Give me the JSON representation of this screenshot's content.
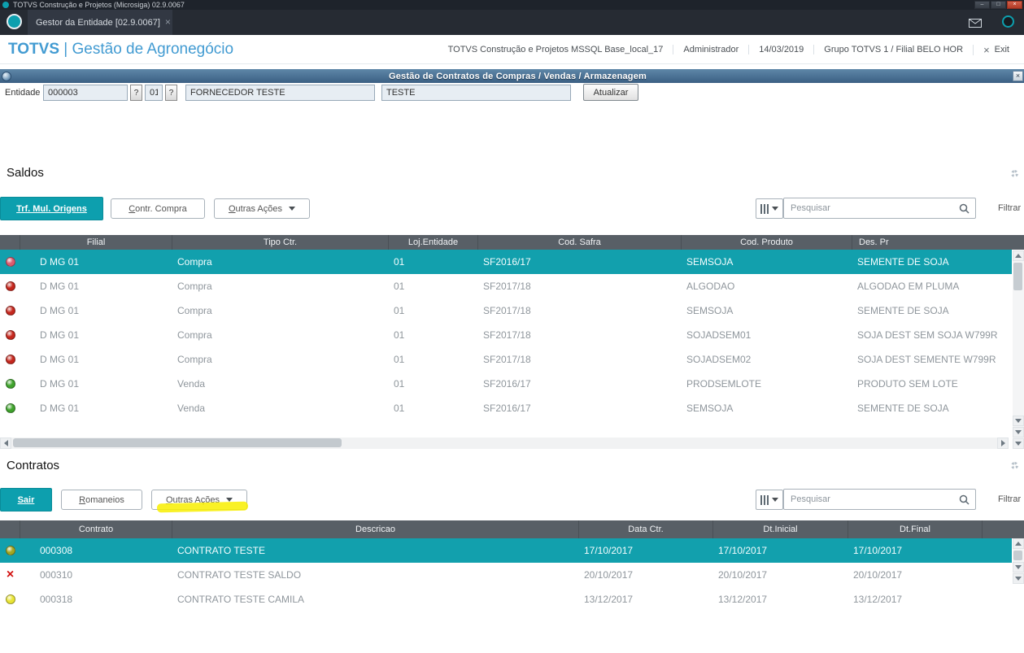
{
  "window": {
    "title": "TOTVS Construção e Projetos (Microsiga) 02.9.0067",
    "minimize": "–",
    "maximize": "□",
    "close": "×"
  },
  "tabbar": {
    "tab_label": "Gestor da Entidade [02.9.0067]",
    "tab_close": "×"
  },
  "header": {
    "brand": "TOTVS",
    "divider": "|",
    "app": "Gestão de Agronegócio",
    "environment": "TOTVS Construção e Projetos MSSQL Base_local_17",
    "user": "Administrador",
    "date": "14/03/2019",
    "group": "Grupo TOTVS 1 / Filial BELO HOR",
    "exit_icon": "×",
    "exit_label": "Exit"
  },
  "dialog": {
    "title": "Gestão de Contratos de Compras / Vendas / Armazenagem",
    "close": "×"
  },
  "form": {
    "label": "Entidade",
    "entity_code": "000003",
    "lookup1": "?",
    "store_code": "01",
    "lookup2": "?",
    "entity_name": "FORNECEDOR TESTE",
    "entity_short": "TESTE",
    "update_button": "Atualizar"
  },
  "saldos": {
    "title": "Saldos",
    "toolbar": {
      "primary": "Trf. Mul. Origens",
      "secondary": "Contr. Compra",
      "more": "Outras Ações",
      "search_placeholder": "Pesquisar",
      "filter": "Filtrar"
    },
    "columns": [
      "",
      "Filial",
      "Tipo Ctr.",
      "Loj.Entidade",
      "Cod. Safra",
      "Cod. Produto",
      "Des. Pr"
    ],
    "rows": [
      {
        "status": "pink",
        "filial": "D MG 01",
        "tipo": "Compra",
        "loja": "01",
        "safra": "SF2016/17",
        "produto": "SEMSOJA",
        "descricao": "SEMENTE DE SOJA"
      },
      {
        "status": "red",
        "filial": "D MG 01",
        "tipo": "Compra",
        "loja": "01",
        "safra": "SF2017/18",
        "produto": "ALGODAO",
        "descricao": "ALGODAO EM PLUMA"
      },
      {
        "status": "red",
        "filial": "D MG 01",
        "tipo": "Compra",
        "loja": "01",
        "safra": "SF2017/18",
        "produto": "SEMSOJA",
        "descricao": "SEMENTE DE SOJA"
      },
      {
        "status": "red",
        "filial": "D MG 01",
        "tipo": "Compra",
        "loja": "01",
        "safra": "SF2017/18",
        "produto": "SOJADSEM01",
        "descricao": "SOJA DEST SEM SOJA W799R"
      },
      {
        "status": "red",
        "filial": "D MG 01",
        "tipo": "Compra",
        "loja": "01",
        "safra": "SF2017/18",
        "produto": "SOJADSEM02",
        "descricao": "SOJA DEST SEMENTE W799R"
      },
      {
        "status": "green",
        "filial": "D MG 01",
        "tipo": "Venda",
        "loja": "01",
        "safra": "SF2016/17",
        "produto": "PRODSEMLOTE",
        "descricao": "PRODUTO SEM LOTE"
      },
      {
        "status": "green",
        "filial": "D MG 01",
        "tipo": "Venda",
        "loja": "01",
        "safra": "SF2016/17",
        "produto": "SEMSOJA",
        "descricao": "SEMENTE DE SOJA"
      }
    ]
  },
  "contratos": {
    "title": "Contratos",
    "toolbar": {
      "primary": "Sair",
      "secondary": "Romaneios",
      "more": "Outras Ações",
      "search_placeholder": "Pesquisar",
      "filter": "Filtrar"
    },
    "columns": [
      "",
      "Contrato",
      "Descricao",
      "Data Ctr.",
      "Dt.Inicial",
      "Dt.Final"
    ],
    "rows": [
      {
        "status": "olive",
        "contrato": "000308",
        "descricao": "CONTRATO TESTE",
        "data_ctr": "17/10/2017",
        "dt_inicial": "17/10/2017",
        "dt_final": "17/10/2017"
      },
      {
        "status": "red-x",
        "contrato": "000310",
        "descricao": "CONTRATO TESTE SALDO",
        "data_ctr": "20/10/2017",
        "dt_inicial": "20/10/2017",
        "dt_final": "20/10/2017"
      },
      {
        "status": "yellow",
        "contrato": "000318",
        "descricao": "CONTRATO TESTE CAMILA",
        "data_ctr": "13/12/2017",
        "dt_inicial": "13/12/2017",
        "dt_final": "13/12/2017"
      }
    ]
  }
}
